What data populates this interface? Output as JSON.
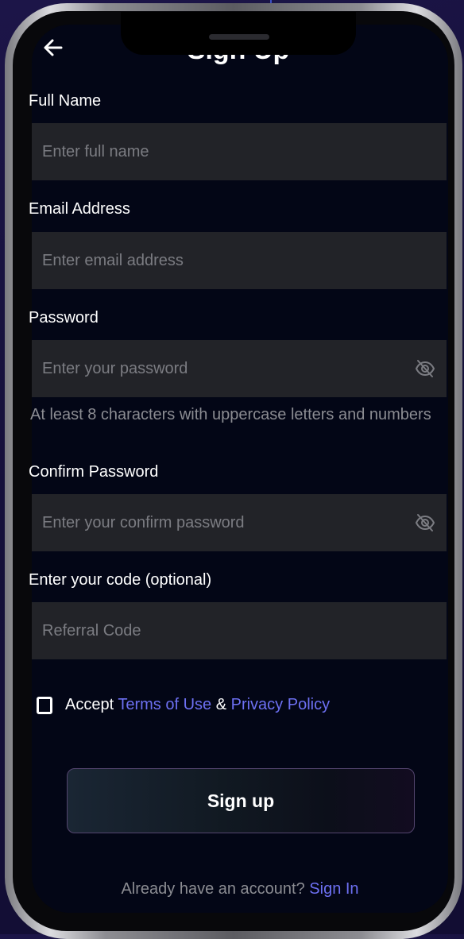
{
  "header": {
    "title": "Sign Up"
  },
  "form": {
    "full_name": {
      "label": "Full Name",
      "placeholder": "Enter full name"
    },
    "email": {
      "label": "Email Address",
      "placeholder": "Enter email address"
    },
    "password": {
      "label": "Password",
      "placeholder": "Enter your password",
      "hint": "At least 8 characters with uppercase letters and numbers"
    },
    "confirm_password": {
      "label": "Confirm Password",
      "placeholder": "Enter your confirm password"
    },
    "referral": {
      "label": "Enter your code (optional)",
      "placeholder": "Referral Code"
    }
  },
  "terms": {
    "checked": false,
    "prefix": "Accept ",
    "terms_link": "Terms of Use",
    "separator": " & ",
    "privacy_link": "Privacy Policy"
  },
  "actions": {
    "signup_label": "Sign up"
  },
  "footer": {
    "prompt": "Already have an account? ",
    "signin_link": "Sign In"
  },
  "icons": {
    "back": "arrow-left-icon",
    "password_toggle": "eye-slash-icon"
  },
  "colors": {
    "background": "#15103a",
    "screen": "#030616",
    "input": "#222328",
    "link": "#6d70f2",
    "placeholder": "#7b7c82"
  }
}
